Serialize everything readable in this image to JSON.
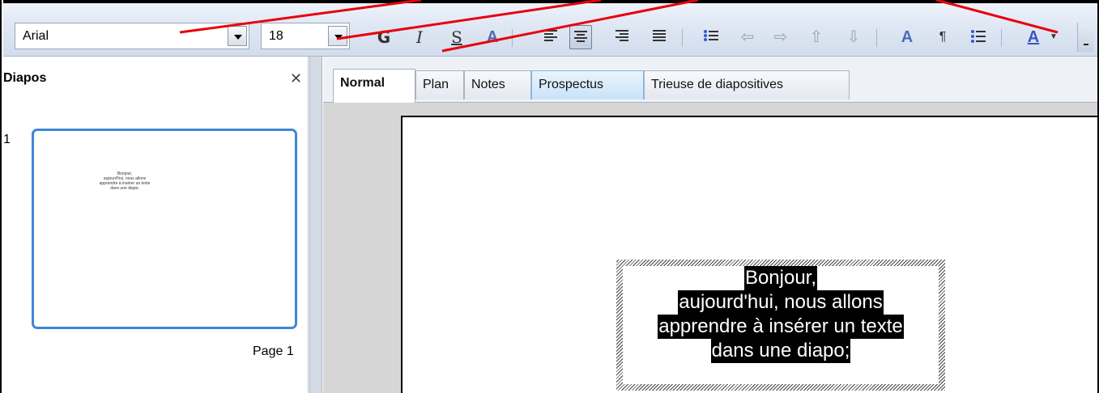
{
  "toolbar": {
    "font_name": "Arial",
    "font_size": "18"
  },
  "slides_panel": {
    "title": "Diapos",
    "slide_number": "1",
    "thumbnail_text": [
      "Bonjour,",
      "aujourd'hui, nous allons",
      "apprendre à insérer un texte",
      "dans une diapo;"
    ],
    "page_label": "Page 1"
  },
  "tabs": [
    {
      "label": "Normal"
    },
    {
      "label": "Plan"
    },
    {
      "label": "Notes"
    },
    {
      "label": "Prospectus"
    },
    {
      "label": "Trieuse de diapositives"
    }
  ],
  "slide": {
    "text_lines": [
      "Bonjour,",
      "aujourd'hui, nous allons",
      "apprendre à insérer un texte",
      "dans une diapo;"
    ]
  },
  "colors": {
    "annotation": "#e8000b",
    "selection_frame": "#3f86d8",
    "highlight": "#000000"
  }
}
